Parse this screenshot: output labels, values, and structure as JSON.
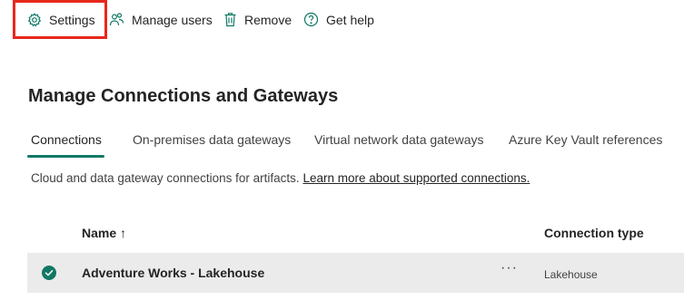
{
  "toolbar": {
    "settings_label": "Settings",
    "manage_users_label": "Manage users",
    "remove_label": "Remove",
    "get_help_label": "Get help"
  },
  "page": {
    "title": "Manage Connections and Gateways"
  },
  "tabs": [
    {
      "label": "Connections",
      "active": true
    },
    {
      "label": "On-premises data gateways",
      "active": false
    },
    {
      "label": "Virtual network data gateways",
      "active": false
    },
    {
      "label": "Azure Key Vault references",
      "active": false
    }
  ],
  "description": {
    "text": "Cloud and data gateway connections for artifacts. ",
    "link": "Learn more about supported connections."
  },
  "table": {
    "columns": [
      {
        "label": "Name ↑"
      },
      {
        "label": "Connection type"
      }
    ],
    "rows": [
      {
        "name": "Adventure Works - Lakehouse",
        "more": "···",
        "type": "Lakehouse",
        "selected": true
      }
    ]
  },
  "colors": {
    "accent": "#117865",
    "highlight_border": "#e8281b",
    "selected_row": "#ebebeb"
  }
}
